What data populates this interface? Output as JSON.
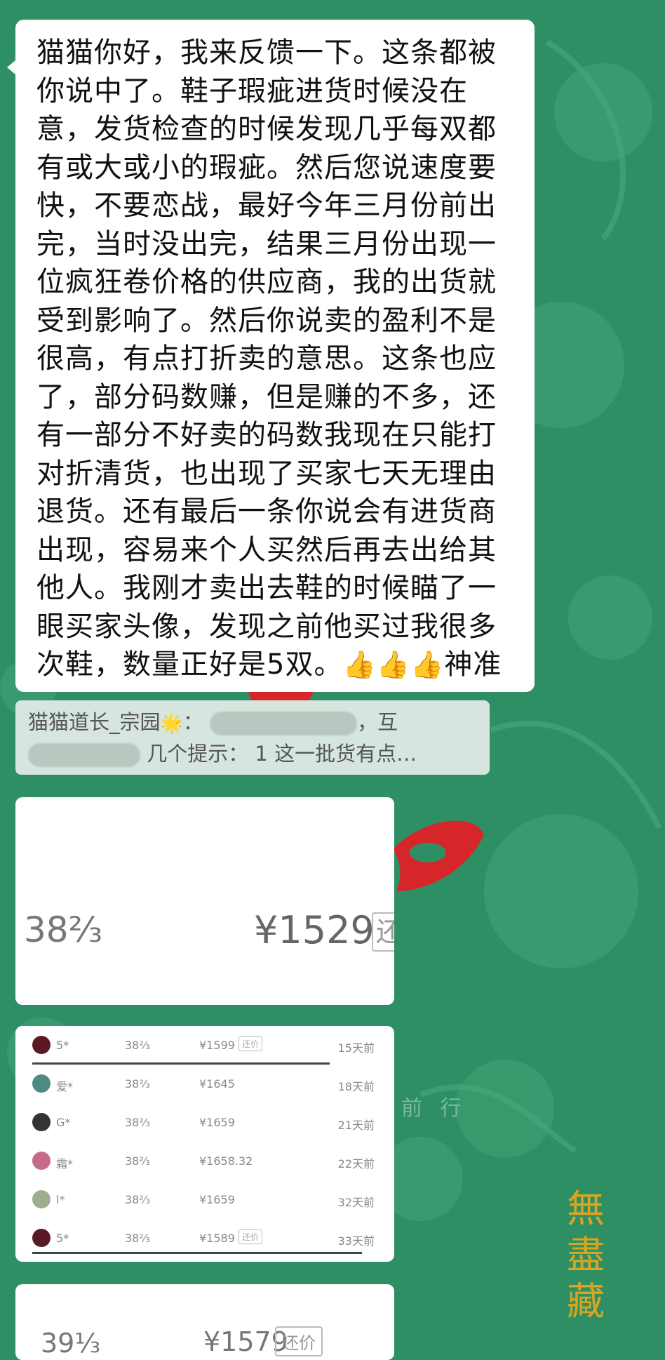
{
  "message": {
    "text": "猫猫你好，我来反馈一下。这条都被你说中了。鞋子瑕疵进货时候没在意，发货检查的时候发现几乎每双都有或大或小的瑕疵。然后您说速度要快，不要恋战，最好今年三月份前出完，当时没出完，结果三月份出现一位疯狂卷价格的供应商，我的出货就受到影响了。然后你说卖的盈利不是很高，有点打折卖的意思。这条也应了，部分码数赚，但是赚的不多，还有一部分不好卖的码数我现在只能打对折清货，也出现了买家七天无理由退货。还有最后一条你说会有进货商出现，容易来个人买然后再去出给其他人。我刚才卖出去鞋的时候瞄了一眼买家头像，发现之前他买过我很多次鞋，数量正好是5双。",
    "thumbs": "👍👍👍",
    "suffix": "神准"
  },
  "quote": {
    "author": "猫猫道长_宗园",
    "star": "🌟",
    "line1_end": "，互",
    "line2": "几个提示：  1 这一批货有点…"
  },
  "card1": {
    "size": "38⅔",
    "price": "¥1529",
    "button": "还"
  },
  "card2": {
    "rows": [
      {
        "name": "5*",
        "size": "38⅔",
        "price": "¥1599",
        "badge": "还价",
        "time": "15天前",
        "avatar_color": "#5a1a24"
      },
      {
        "name": "爱*",
        "size": "38⅔",
        "price": "¥1645",
        "badge": "",
        "time": "18天前",
        "avatar_color": "#4d8a86"
      },
      {
        "name": "G*",
        "size": "38⅔",
        "price": "¥1659",
        "badge": "",
        "time": "21天前",
        "avatar_color": "#333333"
      },
      {
        "name": "霜*",
        "size": "38⅔",
        "price": "¥1658.32",
        "badge": "",
        "time": "22天前",
        "avatar_color": "#c86a8a"
      },
      {
        "name": "l*",
        "size": "38⅔",
        "price": "¥1659",
        "badge": "",
        "time": "32天前",
        "avatar_color": "#9fae8c"
      },
      {
        "name": "5*",
        "size": "38⅔",
        "price": "¥1589",
        "badge": "还价",
        "time": "33天前",
        "avatar_color": "#5a1a24"
      }
    ]
  },
  "card3": {
    "size": "39⅓",
    "price": "¥1579",
    "button": "还价"
  },
  "background": {
    "seal_text": "無盡藏",
    "caption": "前 行",
    "base_color": "#2f8f64",
    "accent_red": "#d6262a",
    "gold": "#d9a521"
  }
}
